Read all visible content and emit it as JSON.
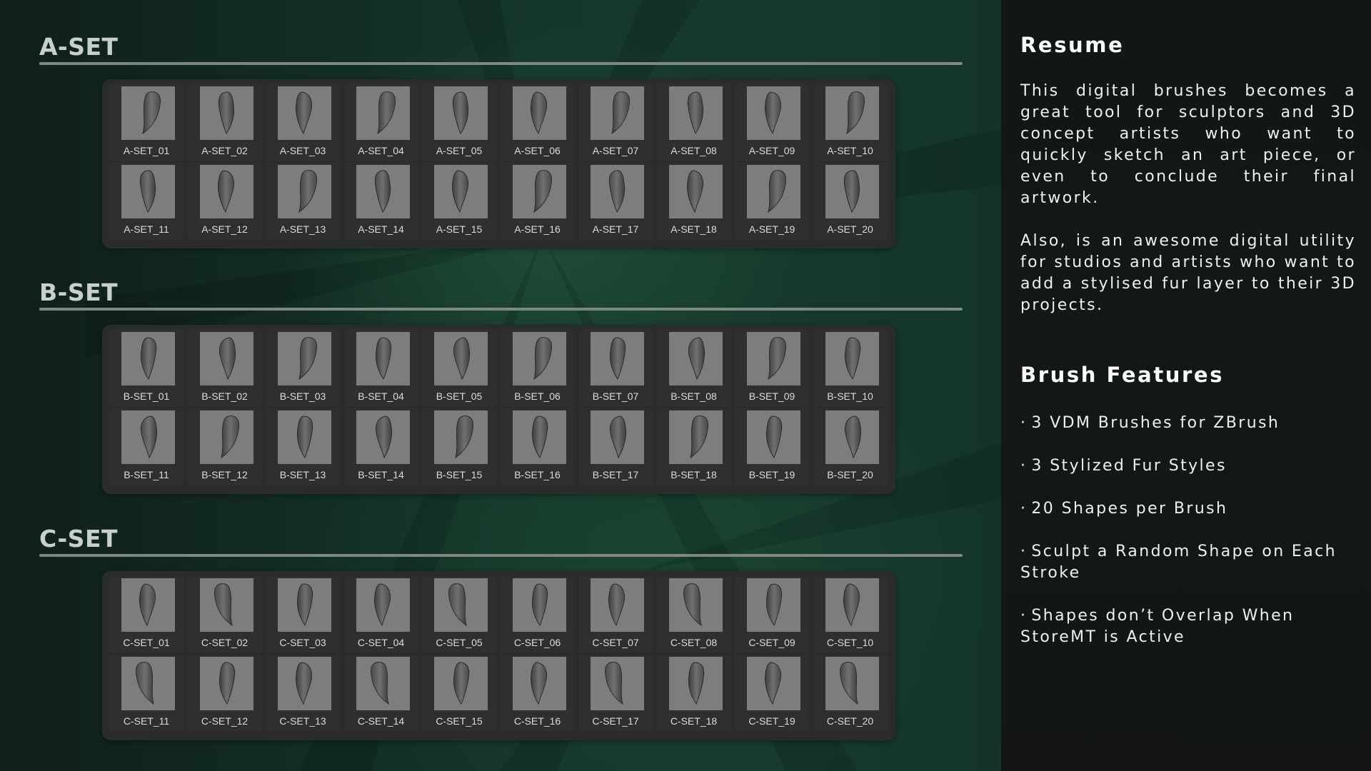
{
  "sets": [
    {
      "title": "A-SET",
      "items": [
        "A-SET_01",
        "A-SET_02",
        "A-SET_03",
        "A-SET_04",
        "A-SET_05",
        "A-SET_06",
        "A-SET_07",
        "A-SET_08",
        "A-SET_09",
        "A-SET_10",
        "A-SET_11",
        "A-SET_12",
        "A-SET_13",
        "A-SET_14",
        "A-SET_15",
        "A-SET_16",
        "A-SET_17",
        "A-SET_18",
        "A-SET_19",
        "A-SET_20"
      ]
    },
    {
      "title": "B-SET",
      "items": [
        "B-SET_01",
        "B-SET_02",
        "B-SET_03",
        "B-SET_04",
        "B-SET_05",
        "B-SET_06",
        "B-SET_07",
        "B-SET_08",
        "B-SET_09",
        "B-SET_10",
        "B-SET_11",
        "B-SET_12",
        "B-SET_13",
        "B-SET_14",
        "B-SET_15",
        "B-SET_16",
        "B-SET_17",
        "B-SET_18",
        "B-SET_19",
        "B-SET_20"
      ]
    },
    {
      "title": "C-SET",
      "items": [
        "C-SET_01",
        "C-SET_02",
        "C-SET_03",
        "C-SET_04",
        "C-SET_05",
        "C-SET_06",
        "C-SET_07",
        "C-SET_08",
        "C-SET_09",
        "C-SET_10",
        "C-SET_11",
        "C-SET_12",
        "C-SET_13",
        "C-SET_14",
        "C-SET_15",
        "C-SET_16",
        "C-SET_17",
        "C-SET_18",
        "C-SET_19",
        "C-SET_20"
      ]
    }
  ],
  "thumbnail_icon": "fur-strand-icon",
  "sidebar": {
    "resume_title": "Resume",
    "resume_p1": "This digital brushes becomes a great tool for sculptors and 3D concept artists who want to quickly sketch an art piece, or even to conclude their final artwork.",
    "resume_p2": "Also, is an awesome digital utility for studios and artists who want to add a stylised fur layer to their 3D projects.",
    "features_title": "Brush Features",
    "bullet": "·",
    "features": [
      "3 VDM Brushes for ZBrush",
      "3 Stylized Fur Styles",
      "20 Shapes per Brush",
      "Sculpt a Random Shape on Each Stroke",
      "Shapes don’t Overlap When StoreMT is Active"
    ]
  },
  "colors": {
    "background_green": "#15372a",
    "panel": "#2a2b2b",
    "thumbnail": "#7d7d7d",
    "sidebar": "#121714",
    "title_text": "#c9cfcb"
  }
}
